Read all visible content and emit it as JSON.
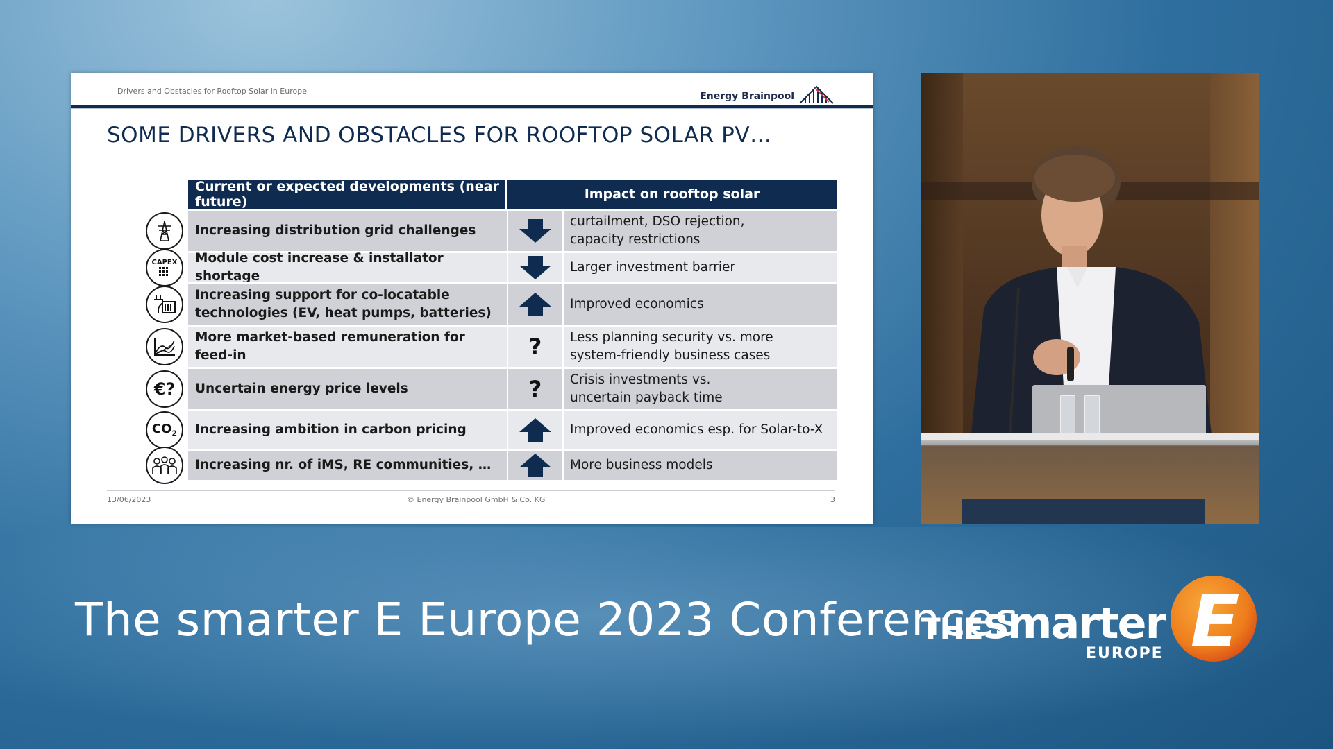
{
  "slide": {
    "header_subtitle": "Drivers and Obstacles for Rooftop Solar in Europe",
    "brand_name": "Energy Brainpool",
    "title": "SOME DRIVERS AND OBSTACLES FOR ROOFTOP SOLAR PV…",
    "table": {
      "col1_header": "Current or expected developments (near future)",
      "col2_header": "Impact on rooftop solar",
      "rows": [
        {
          "icon": "power-tower-icon",
          "development": "Increasing distribution grid challenges",
          "impact_symbol": "arrow-down",
          "impact_line1": "curtailment, DSO rejection,",
          "impact_line2": "capacity restrictions"
        },
        {
          "icon": "capex-icon",
          "icon_text": "CAPEX",
          "development": "Module cost increase & installator shortage",
          "impact_symbol": "arrow-down",
          "impact_line1": "Larger investment barrier",
          "impact_line2": ""
        },
        {
          "icon": "plug-battery-icon",
          "development_line1": "Increasing support for co-locatable",
          "development_line2": "technologies (EV, heat pumps, batteries)",
          "impact_symbol": "arrow-up",
          "impact_line1": "Improved economics",
          "impact_line2": ""
        },
        {
          "icon": "market-chart-icon",
          "development": "More market-based remuneration for feed-in",
          "impact_symbol": "?",
          "impact_line1": "Less planning security vs. more",
          "impact_line2": "system-friendly business cases"
        },
        {
          "icon": "euro-question-icon",
          "icon_text": "€?",
          "development": "Uncertain energy price levels",
          "impact_symbol": "?",
          "impact_line1": "Crisis investments vs.",
          "impact_line2": "uncertain payback time"
        },
        {
          "icon": "co2-icon",
          "icon_text": "CO",
          "icon_sub": "2",
          "development": "Increasing ambition in carbon pricing",
          "impact_symbol": "arrow-up",
          "impact_line1": "Improved economics esp. for Solar-to-X",
          "impact_line2": ""
        },
        {
          "icon": "community-icon",
          "development": "Increasing nr. of iMS, RE communities, …",
          "impact_symbol": "arrow-up",
          "impact_line1": "More business models",
          "impact_line2": ""
        }
      ]
    },
    "footer": {
      "date": "13/06/2023",
      "copyright": "© Energy Brainpool GmbH & Co. KG",
      "page": "3"
    },
    "colors": {
      "navy": "#0f2b4f",
      "row_dark": "#cfd1d6",
      "row_light": "#e8e9ec"
    }
  },
  "banner": {
    "conference_title": "The smarter E Europe 2023 Conferences",
    "logo_the": "THE",
    "logo_smarter": "smarter",
    "logo_europe": "EUROPE",
    "logo_letter": "E",
    "colors": {
      "orange": "#f08a1e",
      "orange_dark": "#e0561a"
    }
  }
}
